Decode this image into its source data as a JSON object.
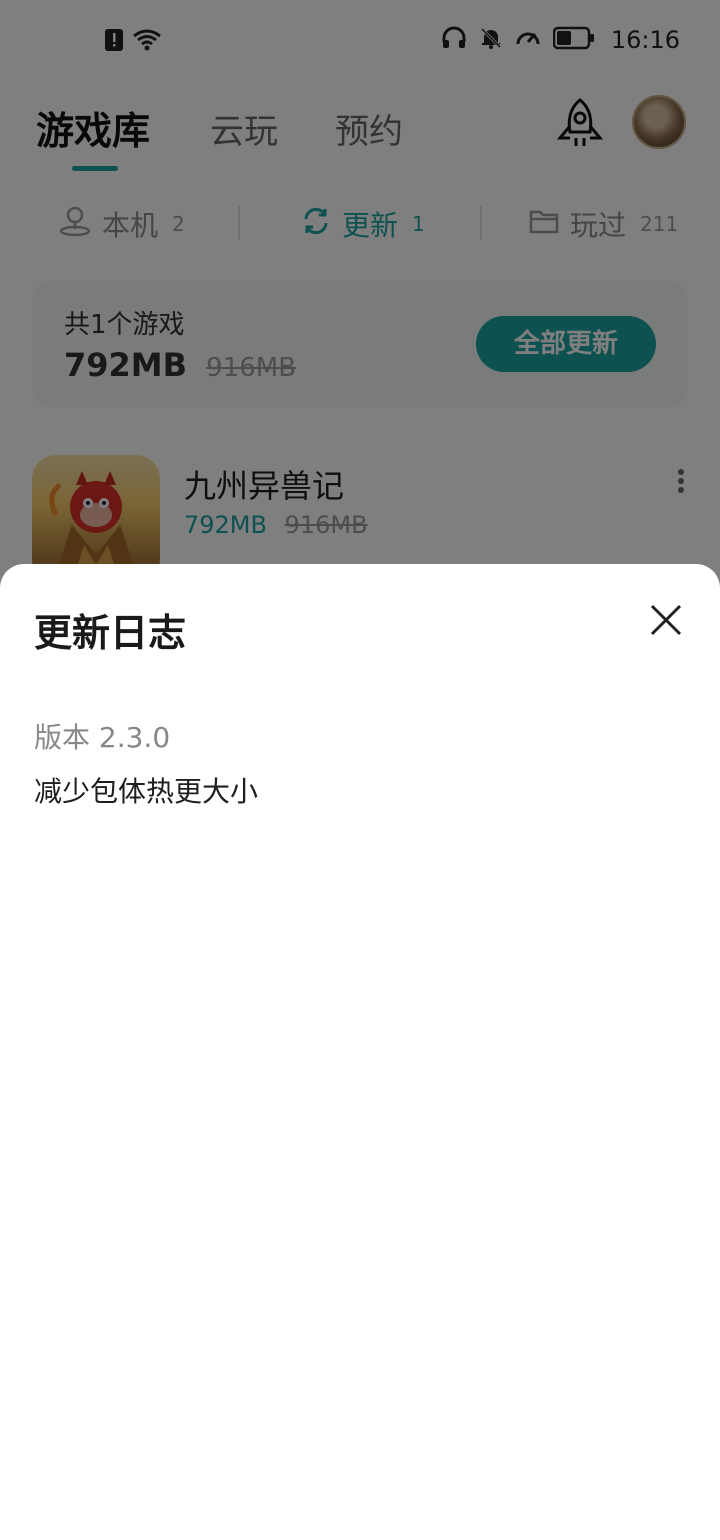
{
  "status_bar": {
    "time": "16:16",
    "icons": [
      "sim-alert-icon",
      "wifi-icon",
      "headphones-icon",
      "bell-off-icon",
      "speedometer-icon",
      "battery-icon"
    ]
  },
  "header": {
    "tabs": [
      {
        "label": "游戏库",
        "active": true
      },
      {
        "label": "云玩",
        "active": false
      },
      {
        "label": "预约",
        "active": false
      }
    ],
    "icons": [
      "rocket-icon",
      "avatar"
    ]
  },
  "subtabs": [
    {
      "label": "本机",
      "count": "2",
      "icon": "person-location-icon"
    },
    {
      "label": "更新",
      "count": "1",
      "icon": "refresh-icon",
      "active": true
    },
    {
      "label": "玩过",
      "count": "211",
      "icon": "folder-icon"
    }
  ],
  "summary": {
    "count_text": "共1个游戏",
    "size": "792MB",
    "old_size": "916MB",
    "update_all_label": "全部更新"
  },
  "game": {
    "title": "九州异兽记",
    "size": "792MB",
    "old_size": "916MB"
  },
  "sheet": {
    "title": "更新日志",
    "version": "版本 2.3.0",
    "note": "减少包体热更大小"
  },
  "colors": {
    "accent": "#1aa3a0",
    "overlay": "rgba(0,0,0,0.5)"
  }
}
